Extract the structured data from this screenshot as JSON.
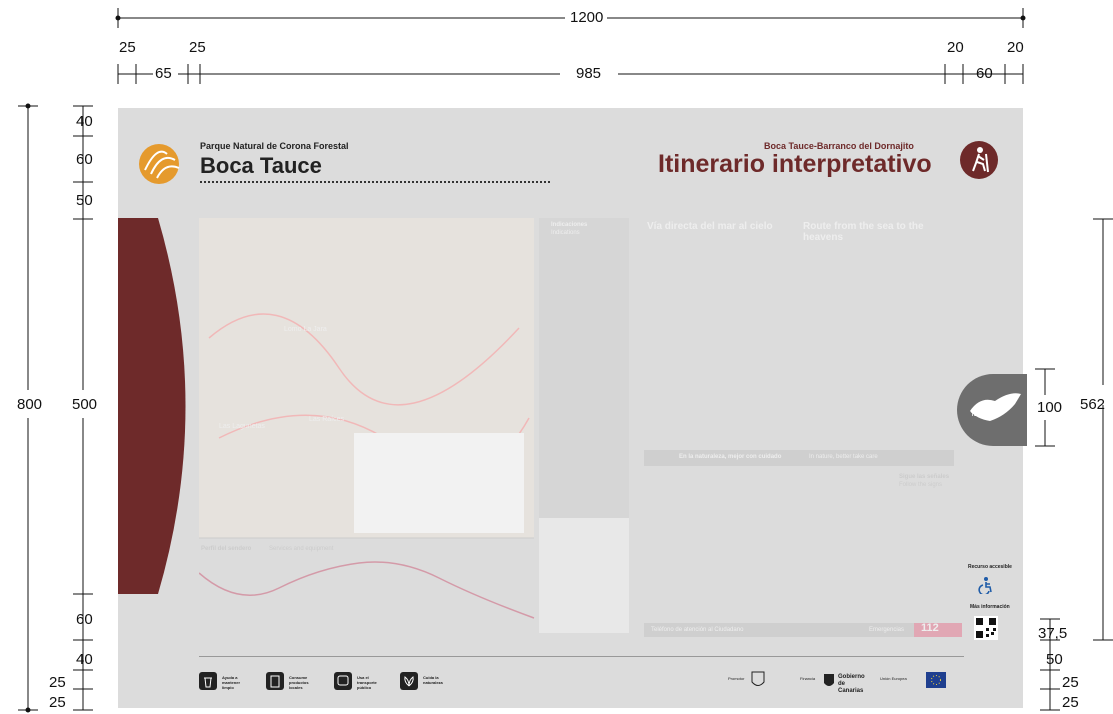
{
  "dimensions": {
    "top_total": "1200",
    "top_parts": [
      "25",
      "65",
      "25",
      "985",
      "20",
      "60",
      "20"
    ],
    "left_total": "800",
    "left_parts": [
      "40",
      "60",
      "50",
      "500",
      "60",
      "40",
      "25",
      "25"
    ],
    "right_total": "562",
    "right_tab": "100",
    "right_bottom_parts": [
      "37,5",
      "50",
      "25",
      "25"
    ]
  },
  "header": {
    "park_name": "Parque Natural de Corona Forestal",
    "place_name": "Boca Tauce",
    "route_name": "Boca Tauce-Barranco del Dornajito",
    "sign_type": "Itinerario interpretativo"
  },
  "content": {
    "map_place_1": "Lomo La Jara",
    "map_place_2": "Las Raíces",
    "map_place_3": "Las Lagunetas",
    "indicaciones_title": "Indicaciones",
    "indicaciones_sub": "Indications",
    "section1_title": "Vía directa del mar al cielo",
    "section2_title": "Route from the sea to the heavens",
    "profile_title": "Perfil del sendero",
    "profile_sub": "Services and equipment",
    "banner": "En la naturaleza, mejor con cuidado",
    "banner_en": "In nature, better take care",
    "signals_title": "Sigue las señales",
    "signals_sub": "Follow the signs",
    "emergency_label": "Emergencias",
    "emergency_number": "112",
    "phone_label": "Teléfono de atención al Ciudadano",
    "tab_label": "TENERIFE"
  },
  "side_info": {
    "accessible": "Recurso accesible",
    "more_info": "Más información"
  },
  "footer": {
    "items": [
      "Ayuda a mantener limpio",
      "Consume productos locales",
      "Usa el transporte público",
      "Cuida la naturaleza"
    ],
    "promotor": "Promotor",
    "financia": "Financia",
    "gobierno": "Gobierno de Canarias",
    "eu": "Unión Europea"
  },
  "colors": {
    "panel": "#dcdcdc",
    "brand": "#6e2a2a",
    "accent_orange": "#e59a2d",
    "dimension_line": "#111111"
  }
}
